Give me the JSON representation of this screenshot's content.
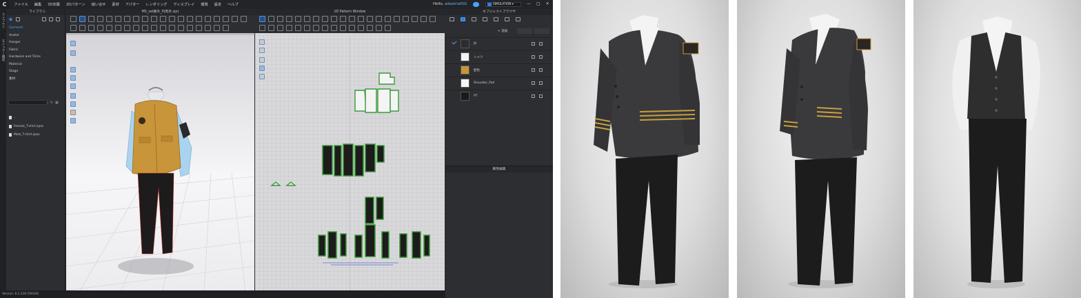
{
  "app": {
    "logo_letter": "C",
    "menu": [
      "ファイル",
      "編集",
      "3D衣服",
      "2Dパターン",
      "縫い合せ",
      "素材",
      "アバター",
      "レンダリング",
      "ディスプレイ",
      "環境",
      "設定",
      "ヘルプ"
    ],
    "greeting": "Hello,",
    "username": "adastria002",
    "mode_label": "SIMULATION",
    "window_controls": [
      "—",
      "□",
      "✕"
    ]
  },
  "vertical_tabs": [
    "ライブラリ",
    "モジュラー構成"
  ],
  "library": {
    "title": "ライブラリ",
    "categories": [
      "Garment",
      "Avatar",
      "Hanger",
      "Fabric",
      "Hardware and Trims",
      "Material",
      "Stage",
      "素材"
    ],
    "active_category": "Garment",
    "files": [
      "..",
      "Female_T-shirt.zpac",
      "Male_T-shirt.zpac"
    ]
  },
  "viewport3d": {
    "title": "MS_set番外_円周月.zprj"
  },
  "pattern_window": {
    "title": "2D Pattern Window"
  },
  "object_browser": {
    "title": "オブジェクトブラウザ",
    "add_label": "+ 追加",
    "materials": [
      {
        "name": "JK",
        "color": "#2c2c2e"
      },
      {
        "name": "シャツ",
        "color": "#f2f2f2"
      },
      {
        "name": "配色",
        "color": "#c9953a"
      },
      {
        "name": "Shoulder_Pad",
        "color": "#f7f7f7"
      },
      {
        "name": "PT",
        "color": "#1a1a1a"
      }
    ]
  },
  "property_editor": {
    "title": "属性編集"
  },
  "status": {
    "version": "Version: 6.2.218 (59164)"
  },
  "colors": {
    "accent": "#2f7de0",
    "app_bg": "#2a2b2e",
    "jacket_mustard": "#c9953a",
    "sleeve_blue": "#a9d3ee",
    "pattern_green": "#3a9a3a"
  },
  "renders": [
    "jacket-uniform-front-left",
    "jacket-uniform-front-right",
    "vest-uniform-front"
  ]
}
